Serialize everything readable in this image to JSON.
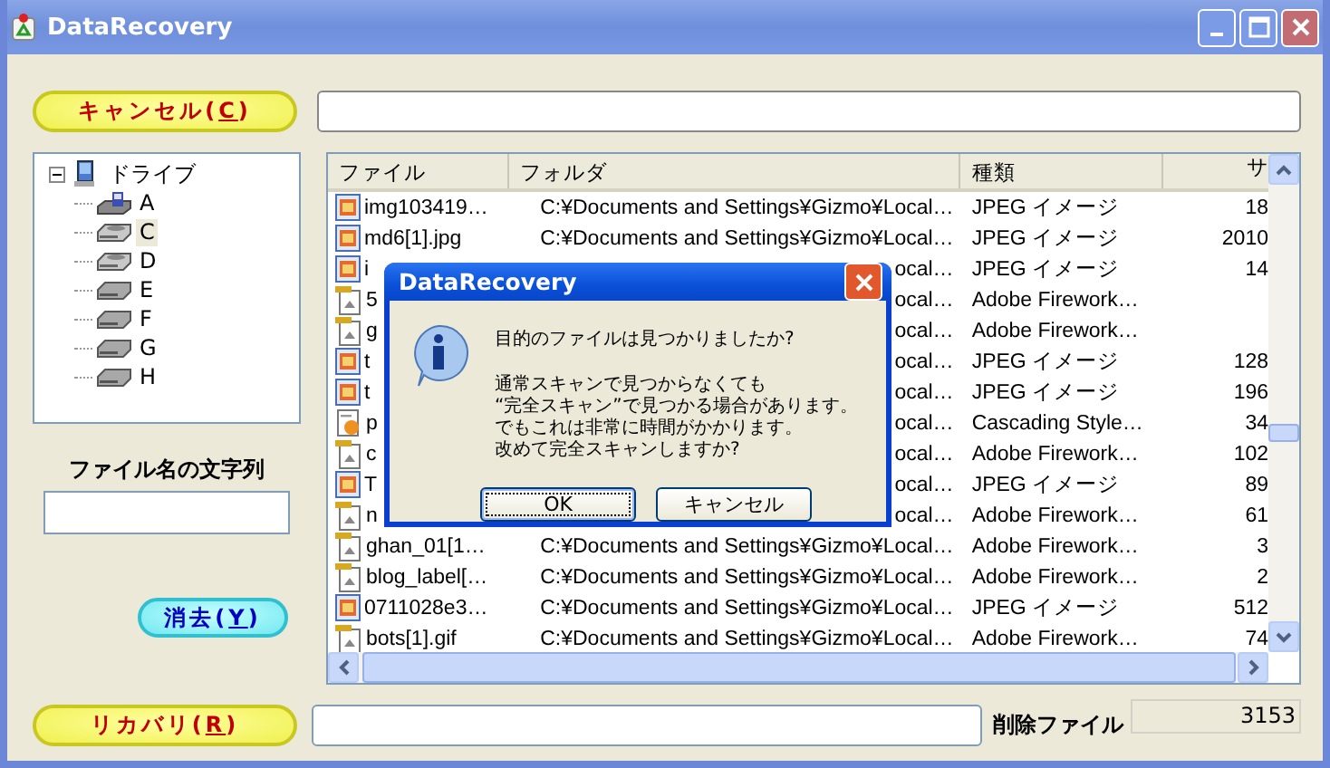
{
  "window": {
    "title": "DataRecovery"
  },
  "cancel_button": {
    "label": "キャンセル(",
    "key": "C",
    "end": ")"
  },
  "tree": {
    "root": {
      "label": "ドライブ",
      "expanded": true,
      "children": [
        {
          "label": "A",
          "kind": "floppy",
          "selected": false
        },
        {
          "label": "C",
          "kind": "optical",
          "selected": true
        },
        {
          "label": "D",
          "kind": "optical",
          "selected": false
        },
        {
          "label": "E",
          "kind": "disk",
          "selected": false
        },
        {
          "label": "F",
          "kind": "disk",
          "selected": false
        },
        {
          "label": "G",
          "kind": "disk",
          "selected": false
        },
        {
          "label": "H",
          "kind": "disk",
          "selected": false
        }
      ]
    }
  },
  "filename_filter": {
    "label": "ファイル名の文字列"
  },
  "clear_button": {
    "label": "消去(",
    "key": "Y",
    "end": ")"
  },
  "table": {
    "columns": [
      "ファイル",
      "フォルダ",
      "種類",
      "サ"
    ],
    "rows": [
      {
        "kind": "jpeg",
        "file": "img103419…",
        "folder": "C:¥Documents and Settings¥Gizmo¥Local…",
        "type": "JPEG イメージ",
        "size": "18"
      },
      {
        "kind": "jpeg",
        "file": "md6[1].jpg",
        "folder": "C:¥Documents and Settings¥Gizmo¥Local…",
        "type": "JPEG イメージ",
        "size": "2010"
      },
      {
        "kind": "jpeg",
        "file": "i",
        "folder": "ocal…",
        "type": "JPEG イメージ",
        "size": "14"
      },
      {
        "kind": "fireworks",
        "file": "5",
        "folder": "ocal…",
        "type": "Adobe Firework…",
        "size": ""
      },
      {
        "kind": "fireworks",
        "file": "g",
        "folder": "ocal…",
        "type": "Adobe Firework…",
        "size": ""
      },
      {
        "kind": "jpeg",
        "file": "t",
        "folder": "ocal…",
        "type": "JPEG イメージ",
        "size": "128"
      },
      {
        "kind": "jpeg",
        "file": "t",
        "folder": "ocal…",
        "type": "JPEG イメージ",
        "size": "196"
      },
      {
        "kind": "css",
        "file": "p",
        "folder": "ocal…",
        "type": "Cascading Style…",
        "size": "34"
      },
      {
        "kind": "fireworks",
        "file": "c",
        "folder": "ocal…",
        "type": "Adobe Firework…",
        "size": "102"
      },
      {
        "kind": "jpeg",
        "file": "T",
        "folder": "ocal…",
        "type": "JPEG イメージ",
        "size": "89"
      },
      {
        "kind": "fireworks",
        "file": "n",
        "folder": "ocal…",
        "type": "Adobe Firework…",
        "size": "61"
      },
      {
        "kind": "fireworks",
        "file": "ghan_01[1…",
        "folder": "C:¥Documents and Settings¥Gizmo¥Local…",
        "type": "Adobe Firework…",
        "size": "3"
      },
      {
        "kind": "fireworks",
        "file": "blog_label[…",
        "folder": "C:¥Documents and Settings¥Gizmo¥Local…",
        "type": "Adobe Firework…",
        "size": "2"
      },
      {
        "kind": "jpeg",
        "file": "0711028e3…",
        "folder": "C:¥Documents and Settings¥Gizmo¥Local…",
        "type": "JPEG イメージ",
        "size": "512"
      },
      {
        "kind": "fireworks",
        "file": "bots[1].gif",
        "folder": "C:¥Documents and Settings¥Gizmo¥Local…",
        "type": "Adobe Firework…",
        "size": "74"
      }
    ]
  },
  "recover_button": {
    "label": "リカバリ(",
    "key": "R",
    "end": ")"
  },
  "deleted_files": {
    "label": "削除ファイル",
    "count": "3153"
  },
  "dialog": {
    "title": "DataRecovery",
    "question": "目的のファイルは見つかりましたか?",
    "body": [
      "通常スキャンで見つからなくても",
      "“完全スキャン”で見つかる場合があります。",
      "でもこれは非常に時間がかかります。",
      "改めて完全スキャンしますか?"
    ],
    "buttons": [
      {
        "label": "OK",
        "selected": true
      },
      {
        "label": "キャンセル",
        "selected": false
      }
    ]
  }
}
